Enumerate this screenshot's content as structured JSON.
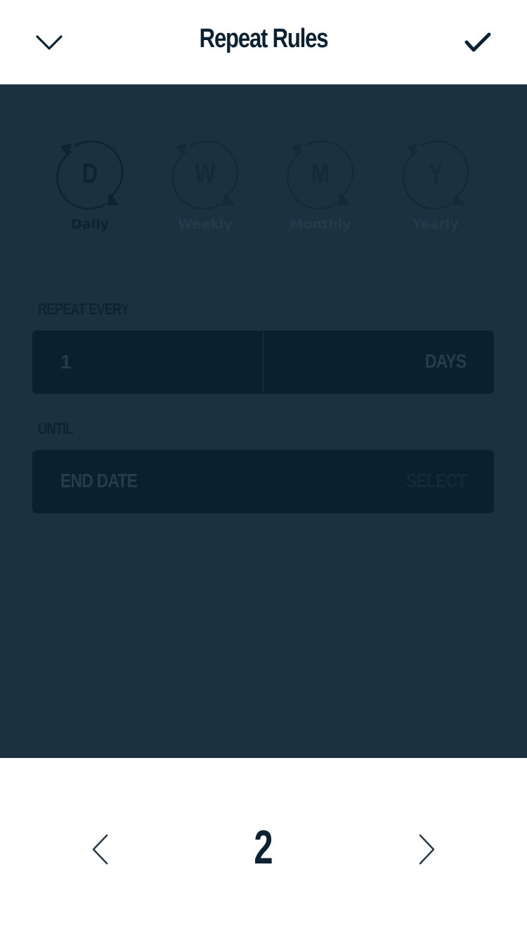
{
  "header": {
    "title": "Repeat Rules",
    "collapse_icon": "chevron-down-icon",
    "confirm_icon": "checkmark-icon"
  },
  "frequencies": [
    {
      "letter": "D",
      "label": "Daily",
      "selected": true
    },
    {
      "letter": "W",
      "label": "Weekly",
      "selected": false
    },
    {
      "letter": "M",
      "label": "Monthly",
      "selected": false
    },
    {
      "letter": "Y",
      "label": "Yearly",
      "selected": false
    }
  ],
  "repeat_every": {
    "label": "REPEAT EVERY",
    "value": "1",
    "unit": "DAYS"
  },
  "until": {
    "label": "UNTIL",
    "placeholder": "END DATE",
    "select_label": "SELECT"
  },
  "footer": {
    "count": "2",
    "prev_icon": "chevron-left-icon",
    "next_icon": "chevron-right-icon"
  },
  "colors": {
    "panel": "#1b3140",
    "field": "#0a202e",
    "ink": "#0c2233"
  }
}
